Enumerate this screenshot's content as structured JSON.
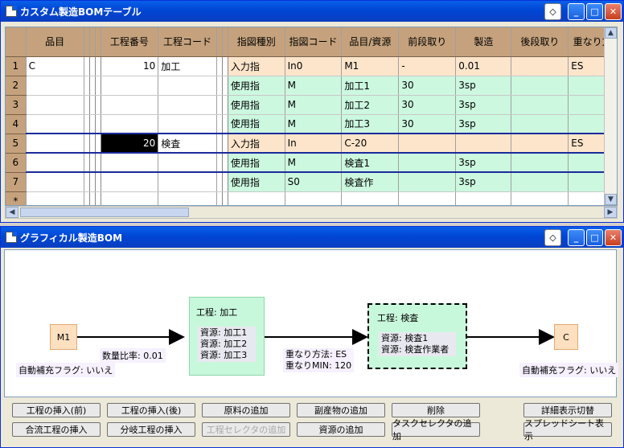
{
  "table_window": {
    "title": "カスタム製造BOMテーブル",
    "columns": [
      "品目",
      "工程番号",
      "工程コード",
      "指図種別",
      "指図コード",
      "品目/資源",
      "前段取り",
      "製造",
      "後段取り",
      "重なり方"
    ],
    "rows": [
      {
        "num": "1",
        "item": "C",
        "proc_no": "10",
        "proc_code": "加工",
        "kind": "入力指",
        "code": "In0",
        "res": "M1",
        "pre": "-",
        "mfg": "0.01",
        "post": "",
        "overlap": "ES",
        "type": "in",
        "sel": false
      },
      {
        "num": "2",
        "item": "",
        "proc_no": "",
        "proc_code": "",
        "kind": "使用指",
        "code": "M",
        "res": "加工1",
        "pre": "30",
        "mfg": "3sp",
        "post": "",
        "overlap": "",
        "type": "use",
        "sel": false
      },
      {
        "num": "3",
        "item": "",
        "proc_no": "",
        "proc_code": "",
        "kind": "使用指",
        "code": "M",
        "res": "加工2",
        "pre": "30",
        "mfg": "3sp",
        "post": "",
        "overlap": "",
        "type": "use",
        "sel": false
      },
      {
        "num": "4",
        "item": "",
        "proc_no": "",
        "proc_code": "",
        "kind": "使用指",
        "code": "M",
        "res": "加工3",
        "pre": "30",
        "mfg": "3sp",
        "post": "",
        "overlap": "",
        "type": "use",
        "sel": false
      },
      {
        "num": "5",
        "item": "",
        "proc_no": "20",
        "proc_code": "検査",
        "kind": "入力指",
        "code": "In",
        "res": "C-20",
        "pre": "",
        "mfg": "",
        "post": "",
        "overlap": "ES",
        "type": "in",
        "sel": true
      },
      {
        "num": "6",
        "item": "",
        "proc_no": "",
        "proc_code": "",
        "kind": "使用指",
        "code": "M",
        "res": "検査1",
        "pre": "",
        "mfg": "3sp",
        "post": "",
        "overlap": "",
        "type": "use",
        "sel": false
      },
      {
        "num": "7",
        "item": "",
        "proc_no": "",
        "proc_code": "",
        "kind": "使用指",
        "code": "S0",
        "res": "検査作",
        "pre": "",
        "mfg": "3sp",
        "post": "",
        "overlap": "",
        "type": "use",
        "sel": false
      }
    ],
    "new_row": "*"
  },
  "graph_window": {
    "title": "グラフィカル製造BOM",
    "m1": "M1",
    "m1_flag": "自動補充フラグ: いいえ",
    "ratio": "数量比率: 0.01",
    "proc1_title": "工程: 加工",
    "proc1_res": [
      "資源: 加工1",
      "資源: 加工2",
      "資源: 加工3"
    ],
    "overlap_method": "重なり方法: ES",
    "overlap_min": "重なりMIN: 120",
    "proc2_title": "工程: 検査",
    "proc2_res": [
      "資源: 検査1",
      "資源: 検査作業者"
    ],
    "c": "C",
    "c_flag": "自動補充フラグ: いいえ",
    "buttons": {
      "ins_before": "工程の挿入(前)",
      "ins_after": "工程の挿入(後)",
      "add_material": "原料の追加",
      "add_byproduct": "副産物の追加",
      "delete": "削除",
      "detail_toggle": "詳細表示切替",
      "merge_proc": "合流工程の挿入",
      "branch_proc": "分岐工程の挿入",
      "add_proc_selector": "工程セレクタの追加",
      "add_resource": "資源の追加",
      "add_task_selector": "タスクセレクタの追加",
      "show_spreadsheet": "スプレッドシート表示"
    }
  }
}
